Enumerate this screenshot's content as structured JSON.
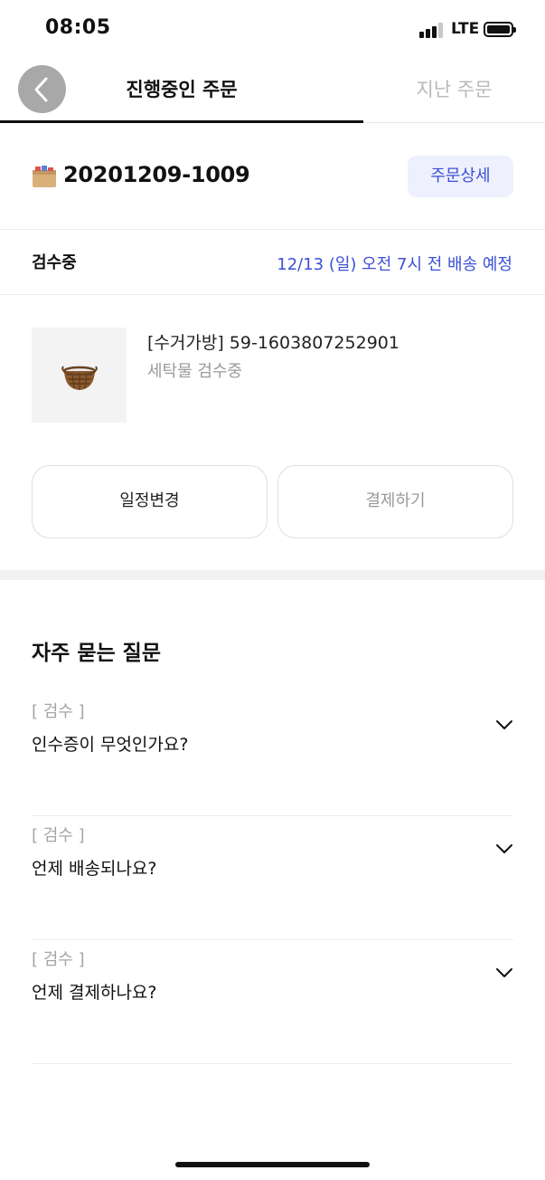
{
  "status_bar": {
    "time": "08:05",
    "network": "LTE",
    "icons": [
      "cellular-signal-icon",
      "battery-icon"
    ]
  },
  "tabs": {
    "current_label": "진행중인 주문",
    "past_label": "지난 주문",
    "back_icon": "chevron-left-icon"
  },
  "order": {
    "icon": "box-icon",
    "number": "20201209-1009",
    "detail_button_label": "주문상세",
    "status_label": "검수중",
    "delivery_eta": "12/13 (일) 오전 7시 전 배송 예정"
  },
  "item": {
    "thumbnail_icon": "laundry-basket-icon",
    "name": "[수거가방] 59-1603807252901",
    "status": "세탁물 검수중"
  },
  "actions": {
    "reschedule_label": "일정변경",
    "pay_label": "결제하기"
  },
  "faq": {
    "title": "자주 묻는 질문",
    "items": [
      {
        "category": "[ 검수 ]",
        "question": "인수증이 무엇인가요?"
      },
      {
        "category": "[ 검수 ]",
        "question": "언제 배송되나요?"
      },
      {
        "category": "[ 검수 ]",
        "question": "언제 결제하나요?"
      }
    ]
  },
  "colors": {
    "accent": "#3b4fd6",
    "accent_bg": "#eef0fd",
    "muted_text": "#9a9a9a",
    "divider": "#ededed"
  }
}
